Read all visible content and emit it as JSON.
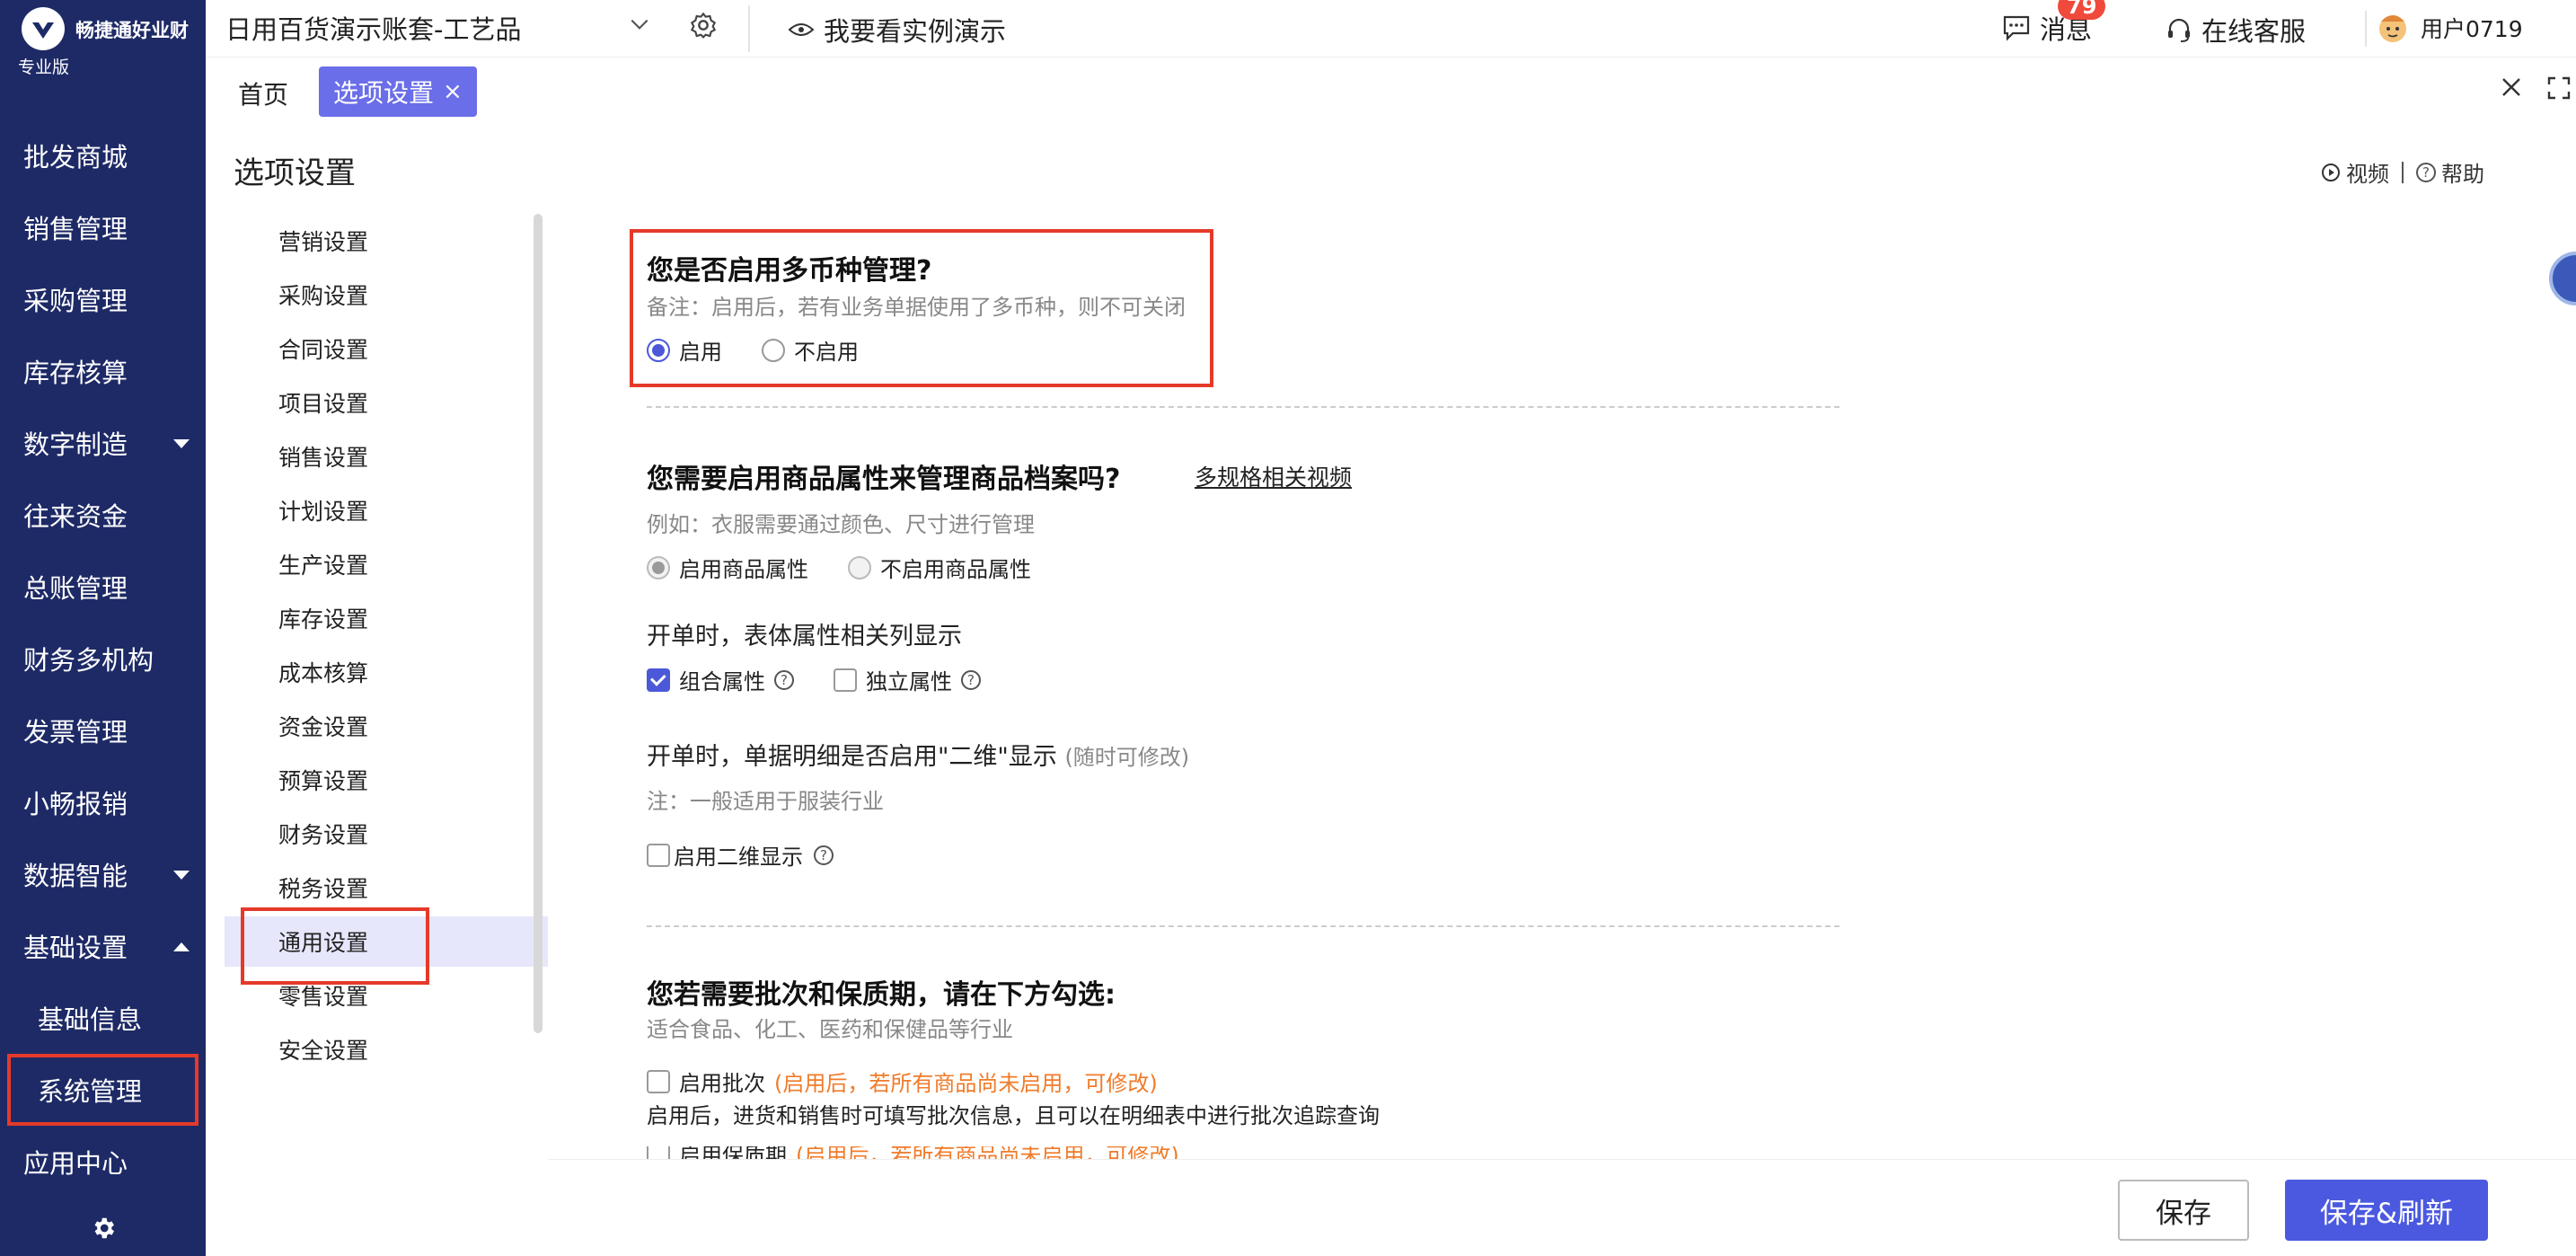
{
  "app": {
    "brand_name": "畅捷通好业财",
    "edition": "专业版",
    "account_name": "日用百货演示账套-工艺品",
    "demo_link": "我要看实例演示",
    "messages_label": "消息",
    "messages_count": "79",
    "service_label": "在线客服",
    "user_label": "用户0719"
  },
  "sidebar": {
    "items": [
      {
        "label": "批发商城"
      },
      {
        "label": "销售管理"
      },
      {
        "label": "采购管理"
      },
      {
        "label": "库存核算"
      },
      {
        "label": "数字制造"
      },
      {
        "label": "往来资金"
      },
      {
        "label": "总账管理"
      },
      {
        "label": "财务多机构"
      },
      {
        "label": "发票管理"
      },
      {
        "label": "小畅报销"
      },
      {
        "label": "数据智能"
      },
      {
        "label": "基础设置"
      },
      {
        "label": "基础信息"
      },
      {
        "label": "系统管理"
      },
      {
        "label": "应用中心"
      }
    ]
  },
  "tabs": {
    "home": "首页",
    "active": "选项设置",
    "close_glyph": "×"
  },
  "page": {
    "title": "选项设置",
    "video_link": "视频",
    "help_link": "帮助"
  },
  "settings_nav": {
    "items": [
      {
        "label": "营销设置"
      },
      {
        "label": "采购设置"
      },
      {
        "label": "合同设置"
      },
      {
        "label": "项目设置"
      },
      {
        "label": "销售设置"
      },
      {
        "label": "计划设置"
      },
      {
        "label": "生产设置"
      },
      {
        "label": "库存设置"
      },
      {
        "label": "成本核算"
      },
      {
        "label": "资金设置"
      },
      {
        "label": "预算设置"
      },
      {
        "label": "财务设置"
      },
      {
        "label": "税务设置"
      },
      {
        "label": "通用设置"
      },
      {
        "label": "零售设置"
      },
      {
        "label": "安全设置"
      }
    ],
    "selected_index": 13
  },
  "currency": {
    "question": "您是否启用多币种管理?",
    "note": "备注：启用后，若有业务单据使用了多币种，则不可关闭",
    "opt_on": "启用",
    "opt_off": "不启用",
    "selected": "启用"
  },
  "attributes": {
    "question": "您需要启用商品属性来管理商品档案吗?",
    "video_link": "多规格相关视频",
    "example": "例如：衣服需要通过颜色、尺寸进行管理",
    "opt_on": "启用商品属性",
    "opt_off": "不启用商品属性",
    "selected": "启用商品属性",
    "column_title": "开单时，表体属性相关列显示",
    "check_combined": "组合属性",
    "check_separate": "独立属性",
    "combined_checked": true,
    "separate_checked": false,
    "twod_title": "开单时，单据明细是否启用\"二维\"显示",
    "twod_hint": "(随时可修改)",
    "twod_note": "注：一般适用于服装行业",
    "twod_check": "启用二维显示"
  },
  "batch": {
    "question": "您若需要批次和保质期，请在下方勾选:",
    "note": "适合食品、化工、医药和保健品等行业",
    "batch_check": "启用批次",
    "batch_hint": "(启用后，若所有商品尚未启用，可修改)",
    "batch_desc": "启用后，进货和销售时可填写批次信息，且可以在明细表中进行批次追踪查询",
    "shelf_check": "启用保质期",
    "shelf_hint": "(启用后，若所有商品尚未启用，可修改)"
  },
  "buttons": {
    "save": "保存",
    "save_refresh": "保存&刷新"
  },
  "colors": {
    "sidebar_bg": "#1e2a66",
    "accent": "#4b59e0",
    "highlight_red": "#e53a2a",
    "warning_orange": "#f07b2a"
  }
}
